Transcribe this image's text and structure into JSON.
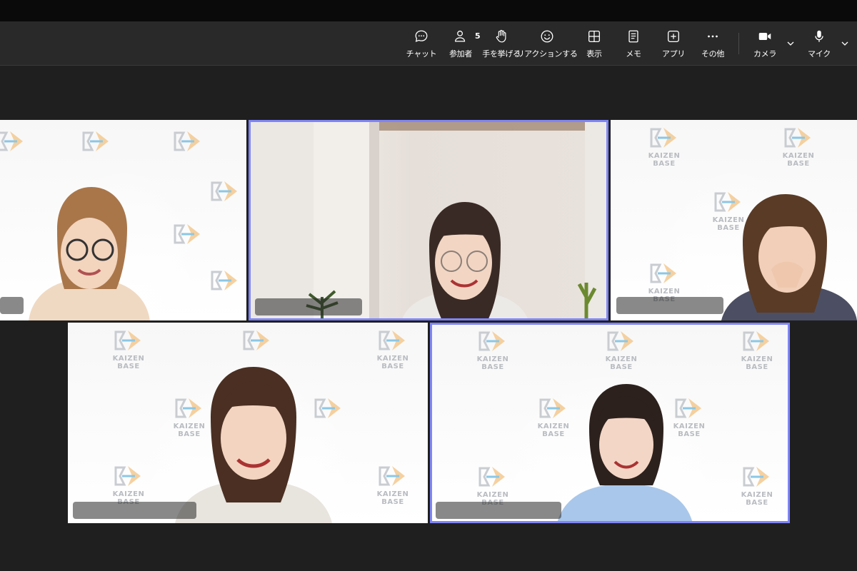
{
  "toolbar": {
    "chat": {
      "label": "チャット",
      "icon": "chat-icon"
    },
    "participants": {
      "label": "参加者",
      "count": "5",
      "icon": "person-icon"
    },
    "raise_hand": {
      "label": "手を挙げる",
      "icon": "hand-icon"
    },
    "reactions": {
      "label": "リアクションする",
      "icon": "smile-icon"
    },
    "view": {
      "label": "表示",
      "icon": "grid-icon"
    },
    "notes": {
      "label": "メモ",
      "icon": "notes-icon"
    },
    "apps": {
      "label": "アプリ",
      "icon": "plus-icon"
    },
    "more": {
      "label": "その他",
      "icon": "more-icon"
    },
    "camera": {
      "label": "カメラ",
      "icon": "camera-icon"
    },
    "mic": {
      "label": "マイク",
      "icon": "mic-icon"
    }
  },
  "watermark_text": "KAIZEN BASE",
  "colors": {
    "active_speaker_border": "#7f85f5",
    "toolbar_bg": "#292929",
    "stage_bg": "#1f1f1f",
    "watermark_orange": "#f3b36a",
    "watermark_blue": "#8cc7e6"
  },
  "tiles": [
    {
      "id": "participant-1",
      "active": false
    },
    {
      "id": "participant-2",
      "active": true
    },
    {
      "id": "participant-3",
      "active": false
    },
    {
      "id": "participant-4",
      "active": false
    },
    {
      "id": "participant-5",
      "active": true
    }
  ]
}
